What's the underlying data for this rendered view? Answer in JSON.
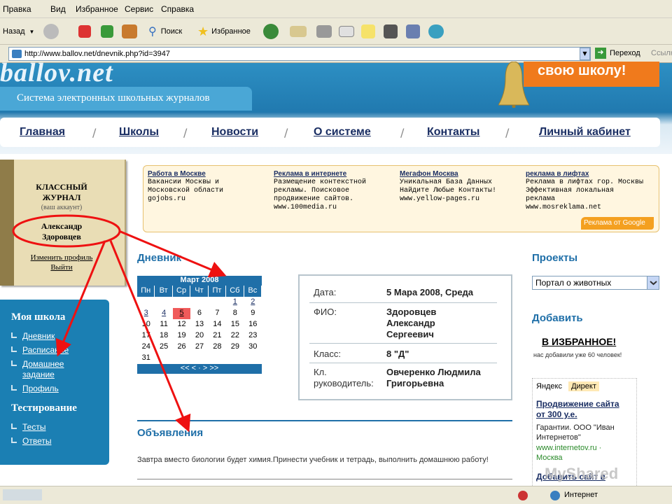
{
  "menu": [
    "Правка",
    "Вид",
    "Избранное",
    "Сервис",
    "Справка"
  ],
  "toolbar": {
    "back": "Назад",
    "search": "Поиск",
    "favorites": "Избранное"
  },
  "address": {
    "url": "http://www.ballov.net/dnevnik.php?id=3947",
    "go": "Переход",
    "links": "Ссылк"
  },
  "site": {
    "logo": "ballov.net",
    "subtitle": "Система электронных школьных журналов",
    "promo": "свою школу!"
  },
  "nav": [
    "Главная",
    "Школы",
    "Новости",
    "О системе",
    "Контакты",
    "Личный кабинет"
  ],
  "journal": {
    "title1": "КЛАССНЫЙ",
    "title2": "ЖУРНАЛ",
    "account": "(ваш аккаунт)",
    "name1": "Александр",
    "name2": "Здоровцев",
    "edit": "Изменить профиль",
    "logout": "Выйти"
  },
  "myschool": {
    "title": "Моя школа",
    "links": [
      "Дневник",
      "Расписание",
      "Домашнее",
      "задание",
      "Профиль"
    ],
    "testing": "Тестирование",
    "test_links": [
      "Тесты",
      "Ответы"
    ]
  },
  "ads": [
    {
      "title": "Работа в Москве",
      "l1": "Вакансии Москвы и",
      "l2": "Московской области",
      "l3": "gojobs.ru",
      "l4": ""
    },
    {
      "title": "Реклама в интернете",
      "l1": "Размещение контекстной",
      "l2": "рекламы. Поисковое",
      "l3": "продвижение сайтов.",
      "l4": "www.100media.ru"
    },
    {
      "title": "Мегафон Москва",
      "l1": "Уникальная База Данных",
      "l2": "Найдите Любые Контакты!",
      "l3": "www.yellow-pages.ru",
      "l4": ""
    },
    {
      "title": "реклама в лифтах",
      "l1": "Реклама в лифтах гор. Москвы",
      "l2": "Эффективная локальная",
      "l3": "реклама",
      "l4": "www.mosreklama.net"
    }
  ],
  "ads_footer": "Реклама от Google",
  "diary": {
    "title": "Дневник",
    "calendar": {
      "month": "Март 2008",
      "weekdays": [
        "Пн",
        "Вт",
        "Ср",
        "Чт",
        "Пт",
        "Сб",
        "Вс"
      ],
      "weeks": [
        [
          "",
          "",
          "",
          "",
          "",
          "1",
          "2"
        ],
        [
          "3",
          "4",
          "5",
          "6",
          "7",
          "8",
          "9"
        ],
        [
          "10",
          "11",
          "12",
          "13",
          "14",
          "15",
          "16"
        ],
        [
          "17",
          "18",
          "19",
          "20",
          "21",
          "22",
          "23"
        ],
        [
          "24",
          "25",
          "26",
          "27",
          "28",
          "29",
          "30"
        ],
        [
          "31",
          "",
          "",
          "",
          "",
          "",
          ""
        ]
      ],
      "nav": "<< < · > >>"
    },
    "info": {
      "date_label": "Дата:",
      "date": "5 Мара 2008, Среда",
      "fio_label": "ФИО:",
      "fio1": "Здоровцев",
      "fio2": "Александр",
      "fio3": "Сергеевич",
      "class_label": "Класс:",
      "class": "8 \"Д\"",
      "head_label1": "Кл.",
      "head_label2": "руководитель:",
      "head1": "Овчеренко Людмила",
      "head2": "Григорьевна"
    }
  },
  "announcements": {
    "title": "Объявления",
    "text": "Завтра вместо биологии будет химия.Принести учебник и тетрадь, выполнить домашнюю работу!"
  },
  "right": {
    "projects": "Проекты",
    "select": "Портал о животных",
    "add": "Добавить",
    "fav": "В ИЗБРАННОЕ!",
    "fav_note": "нас добавили уже 60 человек!",
    "yandex": "Яндекс",
    "direct": "Директ",
    "ad_title1": "Продвижение сайта",
    "ad_title2": "от 300 у.е.",
    "ad_text1": "Гарантии. ООО \"Иван",
    "ad_text2": "Интернетов\"",
    "ad_url1": "www.internetov.ru ·",
    "ad_url2": "Москва",
    "ad_more": "Добавить сайт в"
  },
  "status": {
    "zone": "Интернет"
  },
  "watermark": "MyShared"
}
